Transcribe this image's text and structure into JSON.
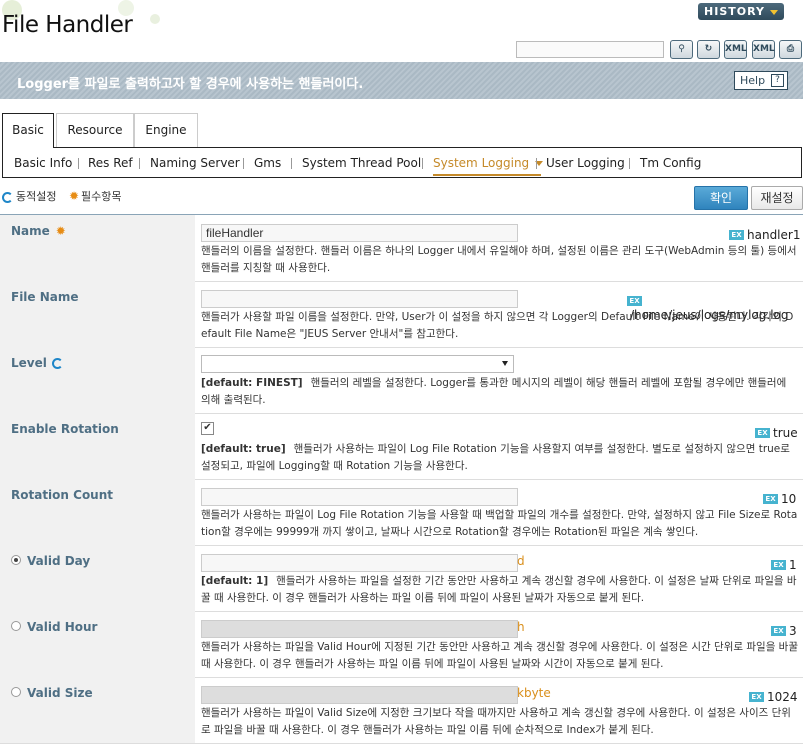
{
  "header": {
    "title": "File Handler",
    "history_label": "HISTORY"
  },
  "toolbar": {
    "icons": [
      "search-icon",
      "refresh-icon",
      "xml-export-icon",
      "xml-import-icon",
      "print-icon"
    ]
  },
  "banner": {
    "text": "Logger를 파일로 출력하고자 할 경우에 사용하는 핸들러이다.",
    "help_label": "Help"
  },
  "tabs": [
    {
      "label": "Basic",
      "active": true
    },
    {
      "label": "Resource",
      "active": false
    },
    {
      "label": "Engine",
      "active": false
    }
  ],
  "subnav": [
    {
      "label": "Basic Info"
    },
    {
      "label": "Res Ref"
    },
    {
      "label": "Naming Server"
    },
    {
      "label": "Gms"
    },
    {
      "label": "System Thread Pool"
    },
    {
      "label": "System Logging",
      "active": true
    },
    {
      "label": "User Logging"
    },
    {
      "label": "Tm Config"
    }
  ],
  "legend": {
    "dynamic": "동적설정",
    "required": "필수항목"
  },
  "actions": {
    "ok_label": "확인",
    "reset_label": "재설정"
  },
  "colors": {
    "accent": "#2f84bd",
    "label": "#4f6f84",
    "unit": "#d98f1c",
    "ex_badge": "#46b3cf",
    "active_tab": "#c58a29"
  },
  "fields": {
    "name": {
      "label": "Name",
      "value": "fileHandler",
      "example": "handler1",
      "desc": "핸들러의 이름을 설정한다. 핸들러 이름은 하나의 Logger 내에서 유일해야 하며, 설정된 이름은 관리 도구(WebAdmin 등의 툴) 등에서 핸들러를 지칭할 때 사용한다."
    },
    "file_name": {
      "label": "File Name",
      "value": "",
      "example": "/home/jeus/logs/mylog.log",
      "desc": "핸들러가 사용할 파일 이름을 설정한다. 만약, User가 이 설정을 하지 않으면 각 Logger의 Default File Name이 사용된다. 각각의 Default File Name은 \"JEUS Server 안내서\"를 참고한다."
    },
    "level": {
      "label": "Level",
      "value": "",
      "default": "[default: FINEST]",
      "desc": "핸들러의 레벨을 설정한다. Logger를 통과한 메시지의 레벨이 해당 핸들러 레벨에 포함될 경우에만 핸들러에 의해 출력된다."
    },
    "enable_rotation": {
      "label": "Enable Rotation",
      "checked": true,
      "example": "true",
      "default": "[default: true]",
      "desc": "핸들러가 사용하는 파일이 Log File Rotation 기능을 사용할지 여부를 설정한다. 별도로 설정하지 않으면 true로 설정되고, 파일에 Logging할 때 Rotation 기능을 사용한다."
    },
    "rotation_count": {
      "label": "Rotation Count",
      "value": "",
      "example": "10",
      "desc": "핸들러가 사용하는 파일이 Log File Rotation 기능을 사용할 때 백업할 파일의 개수를 설정한다. 만약, 설정하지 않고 File Size로 Rotation할 경우에는 99999개 까지 쌓이고, 날짜나 시간으로 Rotation할 경우에는 Rotation된 파일은 계속 쌓인다."
    },
    "valid_day": {
      "label": "Valid Day",
      "selected": true,
      "value": "",
      "unit": "d",
      "example": "1",
      "default": "[default: 1]",
      "desc": "핸들러가 사용하는 파일을 설정한 기간 동안만 사용하고 계속 갱신할 경우에 사용한다. 이 설정은 날짜 단위로 파일을 바꿀 때 사용한다. 이 경우 핸들러가 사용하는 파일 이름 뒤에 파일이 사용된 날짜가 자동으로 붙게 된다."
    },
    "valid_hour": {
      "label": "Valid Hour",
      "selected": false,
      "value": "",
      "unit": "h",
      "example": "3",
      "desc": "핸들러가 사용하는 파일을 Valid Hour에 지정된 기간 동안만 사용하고 계속 갱신할 경우에 사용한다. 이 설정은 시간 단위로 파일을 바꿀 때 사용한다. 이 경우 핸들러가 사용하는 파일 이름 뒤에 파일이 사용된 날짜와 시간이 자동으로 붙게 된다."
    },
    "valid_size": {
      "label": "Valid Size",
      "selected": false,
      "value": "",
      "unit": "kbyte",
      "example": "1024",
      "desc": "핸들러가 사용하는 파일이 Valid Size에 지정한 크기보다 작을 때까지만 사용하고 계속 갱신할 경우에 사용한다. 이 설정은 사이즈 단위로 파일을 바꿀 때 사용한다. 이 경우 핸들러가 사용하는 파일 이름 뒤에 순차적으로 Index가 붙게 된다."
    }
  }
}
